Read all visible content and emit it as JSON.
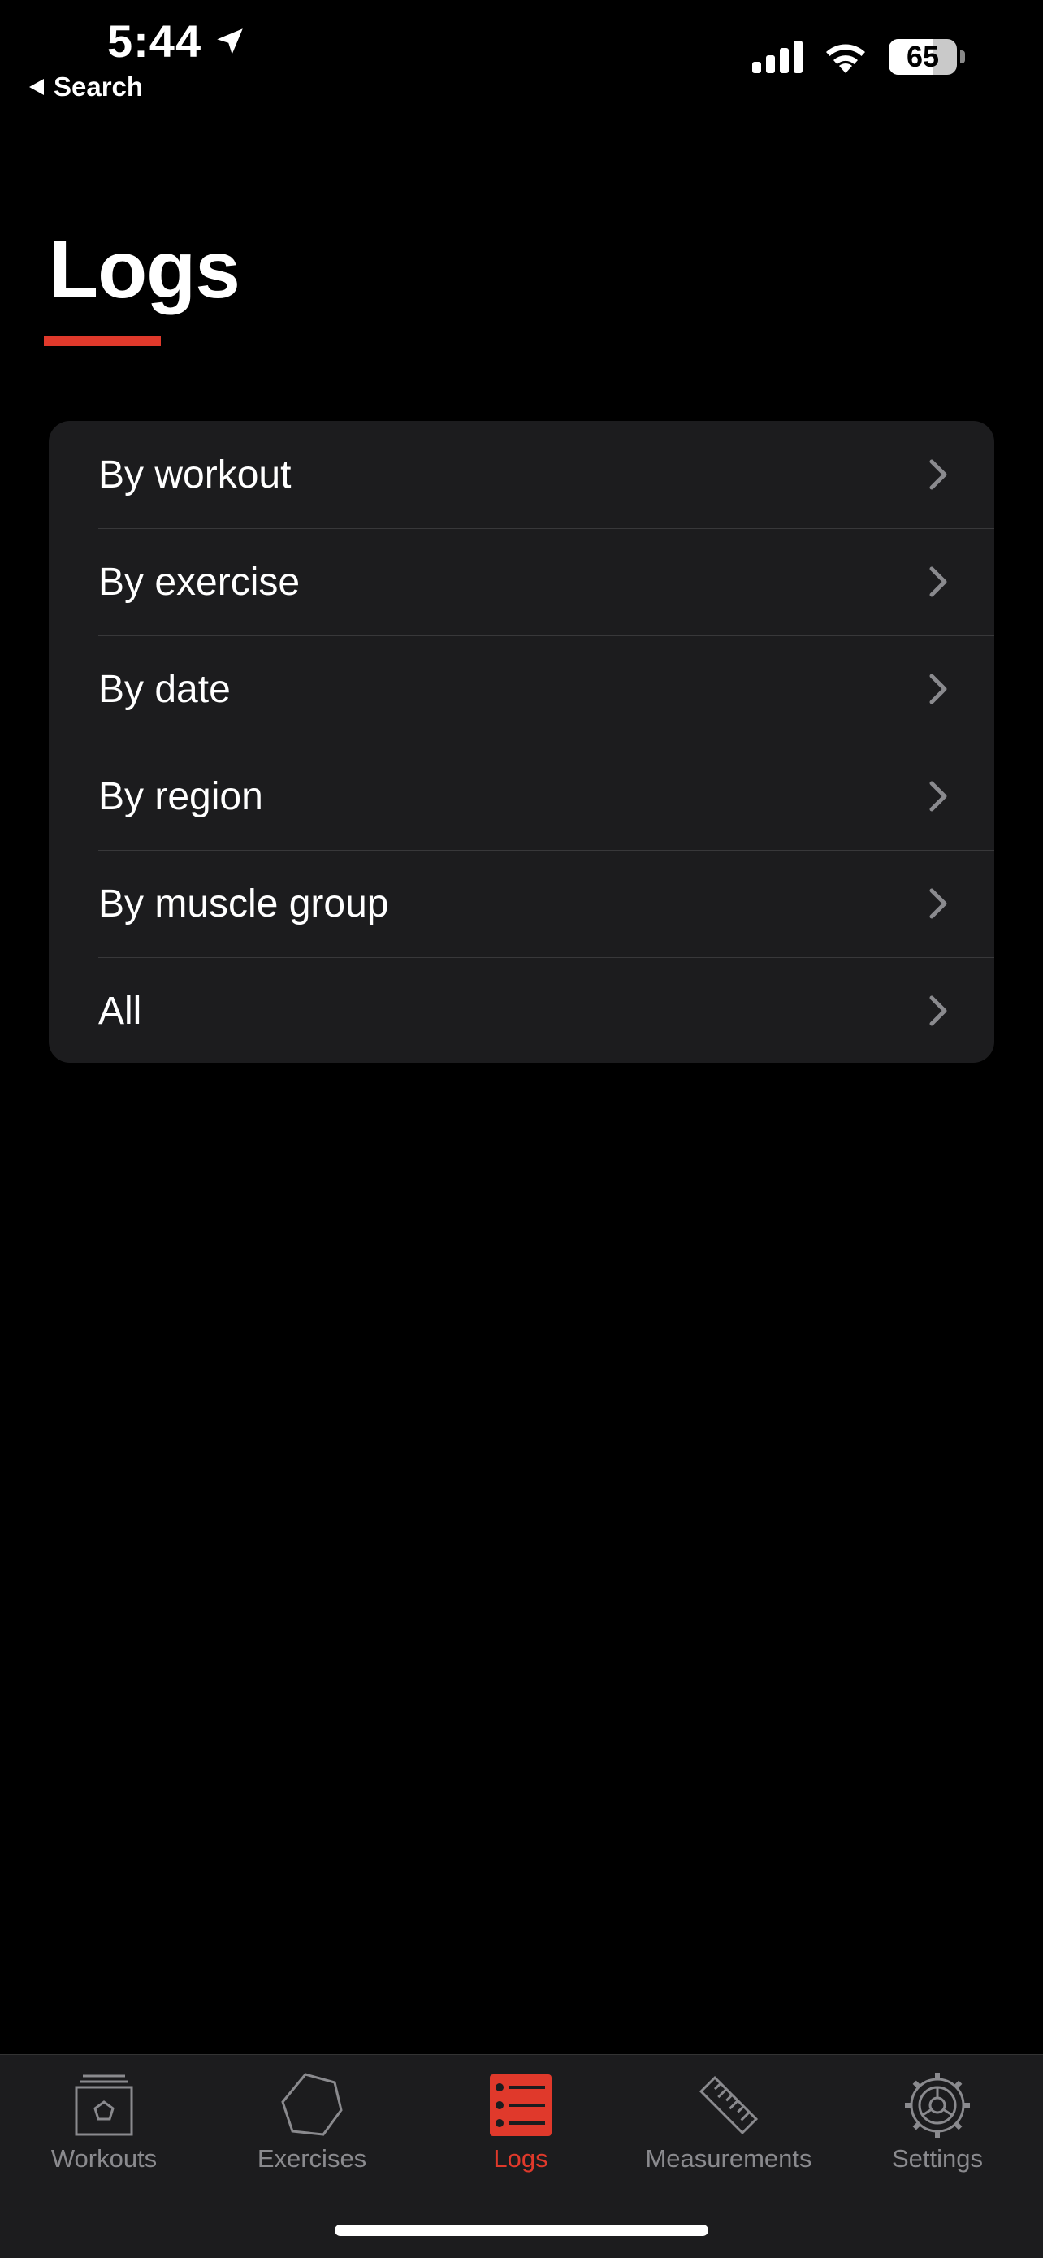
{
  "status_bar": {
    "time": "5:44",
    "back_label": "Search",
    "battery_percent": "65",
    "battery_level": 0.65
  },
  "page": {
    "title": "Logs",
    "accent_color": "#e0392b"
  },
  "menu": {
    "items": [
      {
        "label": "By workout"
      },
      {
        "label": "By exercise"
      },
      {
        "label": "By date"
      },
      {
        "label": "By region"
      },
      {
        "label": "By muscle group"
      },
      {
        "label": "All"
      }
    ]
  },
  "tab_bar": {
    "active": "Logs",
    "tabs": [
      {
        "label": "Workouts",
        "icon": "workouts-icon"
      },
      {
        "label": "Exercises",
        "icon": "hexagon-icon"
      },
      {
        "label": "Logs",
        "icon": "list-icon"
      },
      {
        "label": "Measurements",
        "icon": "ruler-icon"
      },
      {
        "label": "Settings",
        "icon": "gear-icon"
      }
    ]
  }
}
